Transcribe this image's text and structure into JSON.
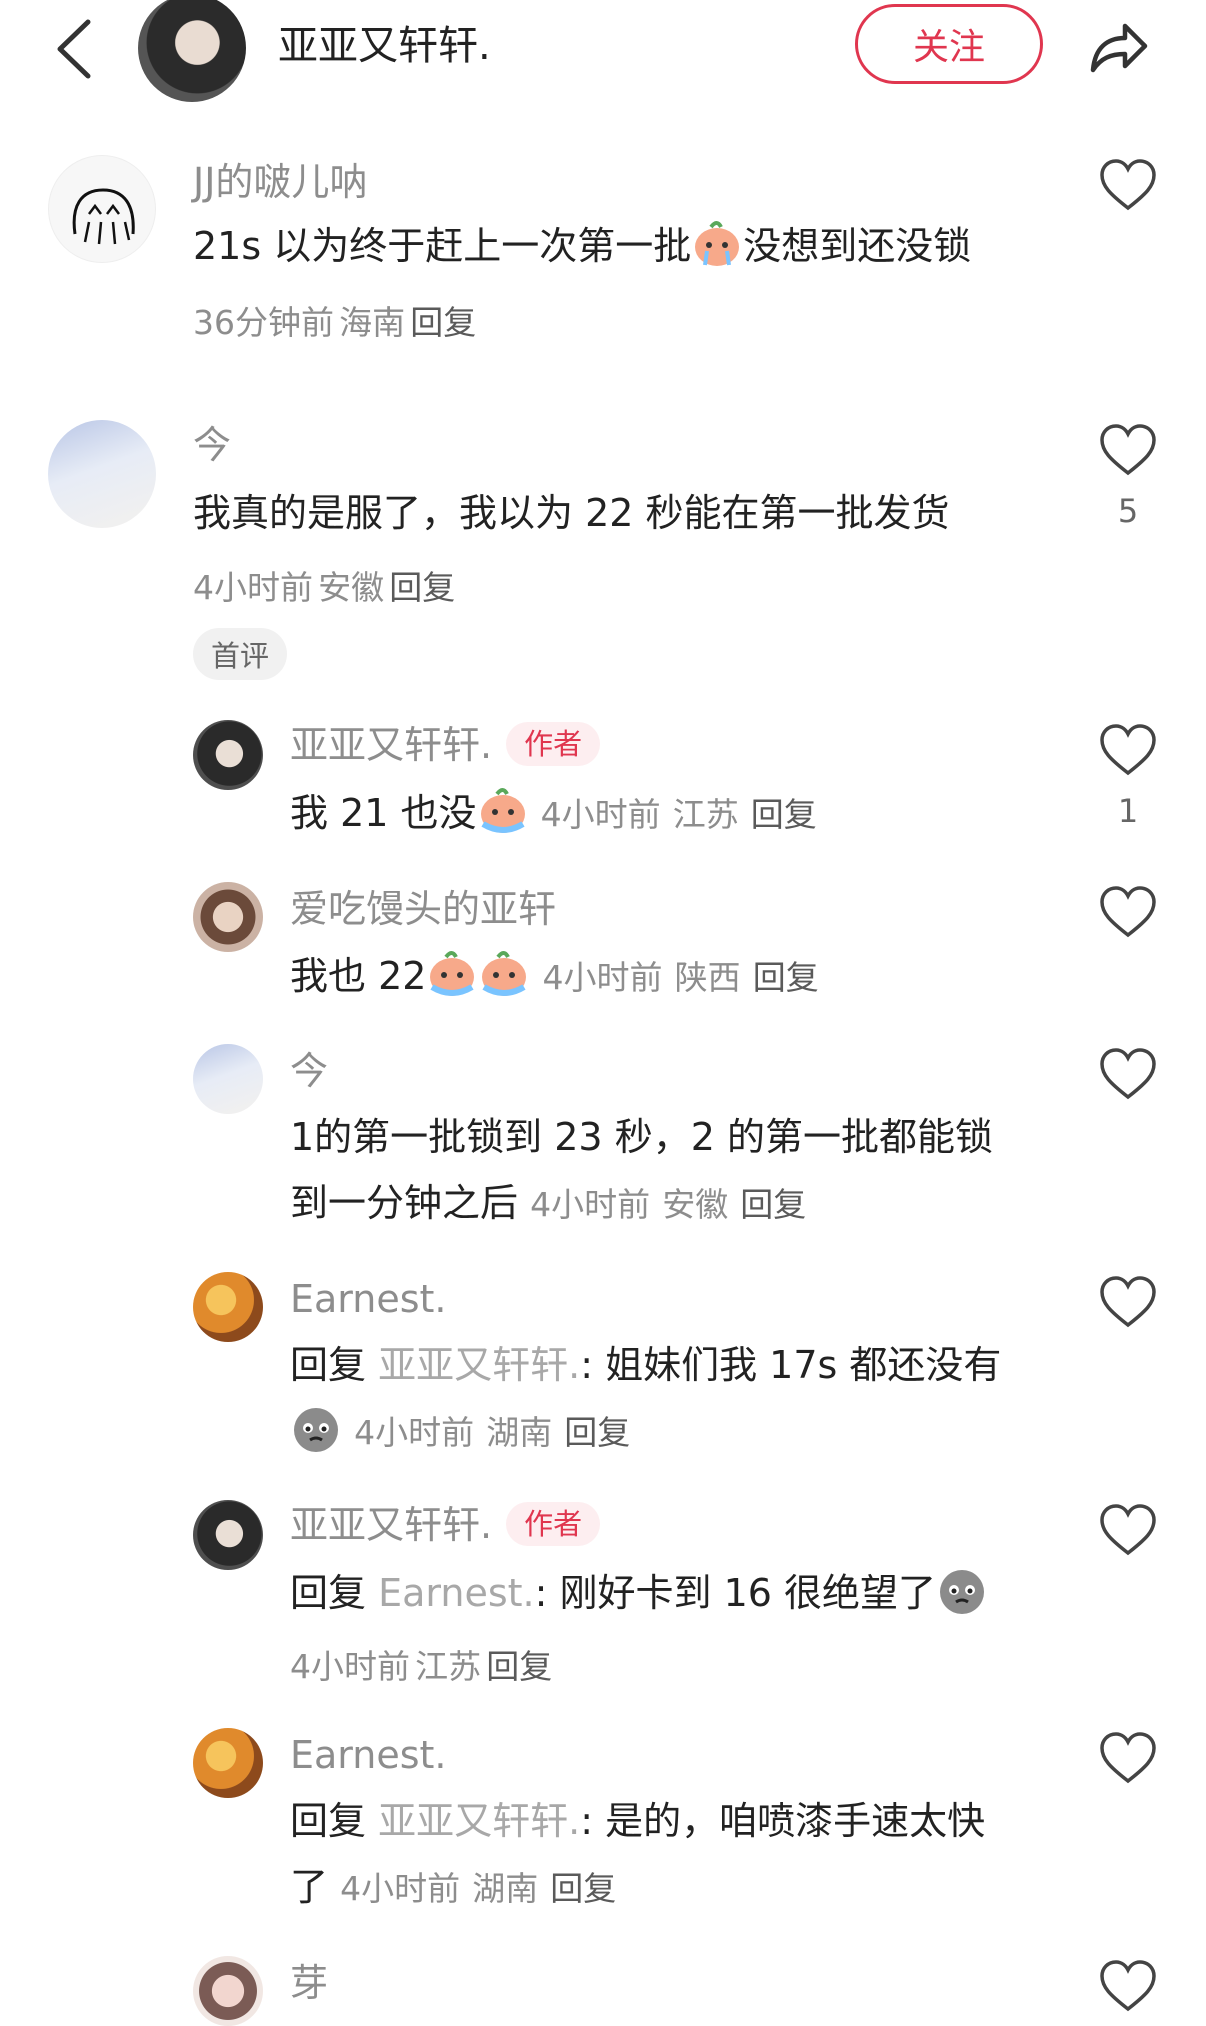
{
  "header": {
    "name": "亚亚又轩轩.",
    "follow_label": "关注"
  },
  "comments": [
    {
      "user": "JJ的啵儿呐",
      "text_before": "21s 以为终于赶上一次第一批",
      "text_after": "没想到还没锁",
      "time": "36分钟前",
      "location": "海南",
      "reply": "回复"
    },
    {
      "user": "今",
      "text": "我真的是服了，我以为 22 秒能在第一批发货",
      "time": "4小时前",
      "location": "安徽",
      "reply": "回复",
      "likes": "5",
      "tag": "首评"
    }
  ],
  "replies": [
    {
      "user": "亚亚又轩轩.",
      "author_tag": "作者",
      "text": "我 21 也没",
      "time": "4小时前",
      "location": "江苏",
      "reply": "回复",
      "likes": "1"
    },
    {
      "user": "爱吃馒头的亚轩",
      "text": "我也 22",
      "time": "4小时前",
      "location": "陕西",
      "reply": "回复"
    },
    {
      "user": "今",
      "text_line1": "1的第一批锁到 23 秒，2 的第一批都能锁",
      "text_line2": "到一分钟之后",
      "time": "4小时前",
      "location": "安徽",
      "reply": "回复"
    },
    {
      "user": "Earnest.",
      "reply_prefix": "回复",
      "mention": "亚亚又轩轩.",
      "text": ": 姐妹们我 17s 都还没有",
      "time": "4小时前",
      "location": "湖南",
      "reply": "回复"
    },
    {
      "user": "亚亚又轩轩.",
      "author_tag": "作者",
      "reply_prefix": "回复",
      "mention": "Earnest.",
      "text": ": 刚好卡到 16 很绝望了",
      "time": "4小时前",
      "location": "江苏",
      "reply": "回复"
    },
    {
      "user": "Earnest.",
      "reply_prefix": "回复",
      "mention": "亚亚又轩轩.",
      "text": ": 是的，咱喷漆手速太快",
      "text_line2": "了",
      "time": "4小时前",
      "location": "湖南",
      "reply": "回复"
    },
    {
      "user": "芽"
    }
  ],
  "icons": {
    "back": "chevron-left-icon",
    "share": "share-arrow-icon",
    "like": "heart-outline-icon"
  },
  "colors": {
    "accent": "#e0364f",
    "meta": "#8d8d8d"
  }
}
